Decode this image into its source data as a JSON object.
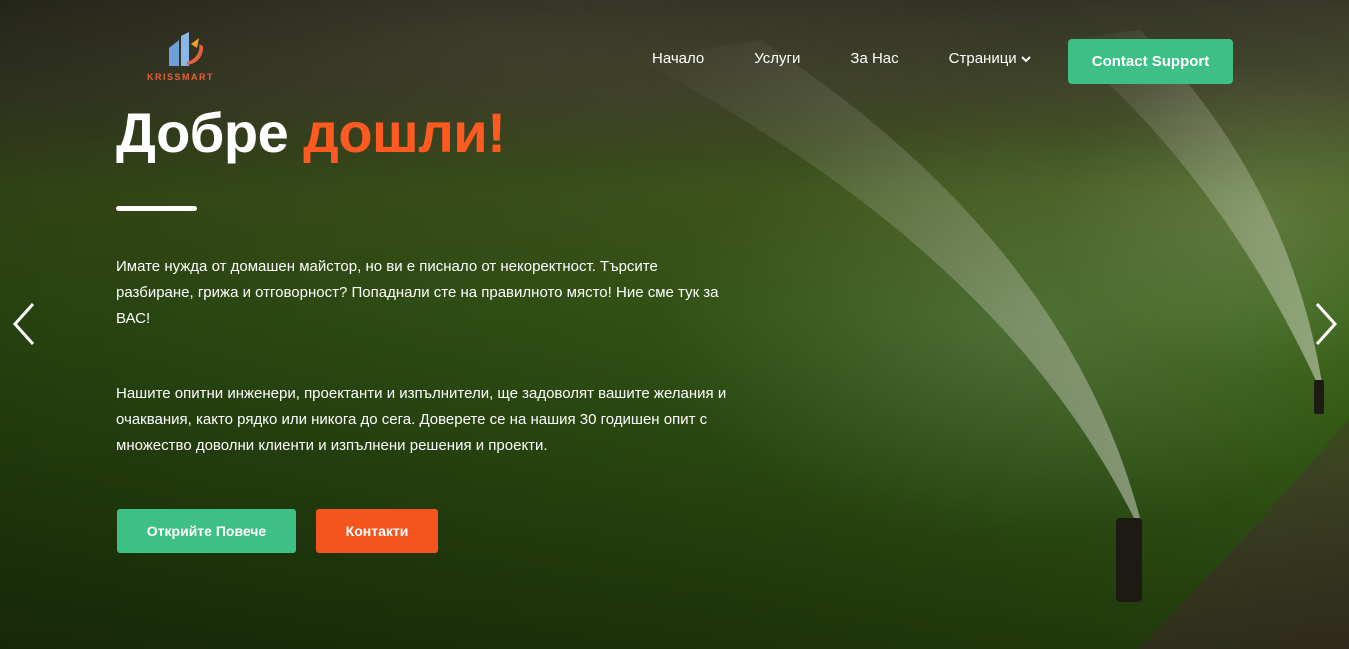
{
  "brand": {
    "name": "KRISSMART",
    "color": "#e5603a"
  },
  "nav": {
    "items": [
      {
        "label": "Начало"
      },
      {
        "label": "Услуги"
      },
      {
        "label": "За Нас"
      },
      {
        "label": "Страници"
      }
    ],
    "cta_label": "Contact Support"
  },
  "hero": {
    "title_part1": "Добре",
    "title_part2": "дошли!",
    "paragraph1": "Имате нужда от домашен майстор, но ви е писнало от некоректност. Търсите разбиране, грижа и отговорност? Попаднали сте на правилното място! Ние сме тук за ВАС!",
    "paragraph2": "Нашите опитни инженери, проектанти и изпълнители, ще задоволят вашите желания и очаквания, както рядко или никога до сега. Доверете се на нашия 30 годишен опит с множество доволни клиенти и изпълнени решения и проекти.",
    "btn_discover": "Открийте Повече",
    "btn_contacts": "Контакти"
  },
  "slider": {
    "prev_icon": "chevron-left-icon",
    "next_icon": "chevron-right-icon"
  },
  "colors": {
    "green": "#3dbf85",
    "orange": "#f5541d",
    "accent_text": "#ff5a1f"
  }
}
